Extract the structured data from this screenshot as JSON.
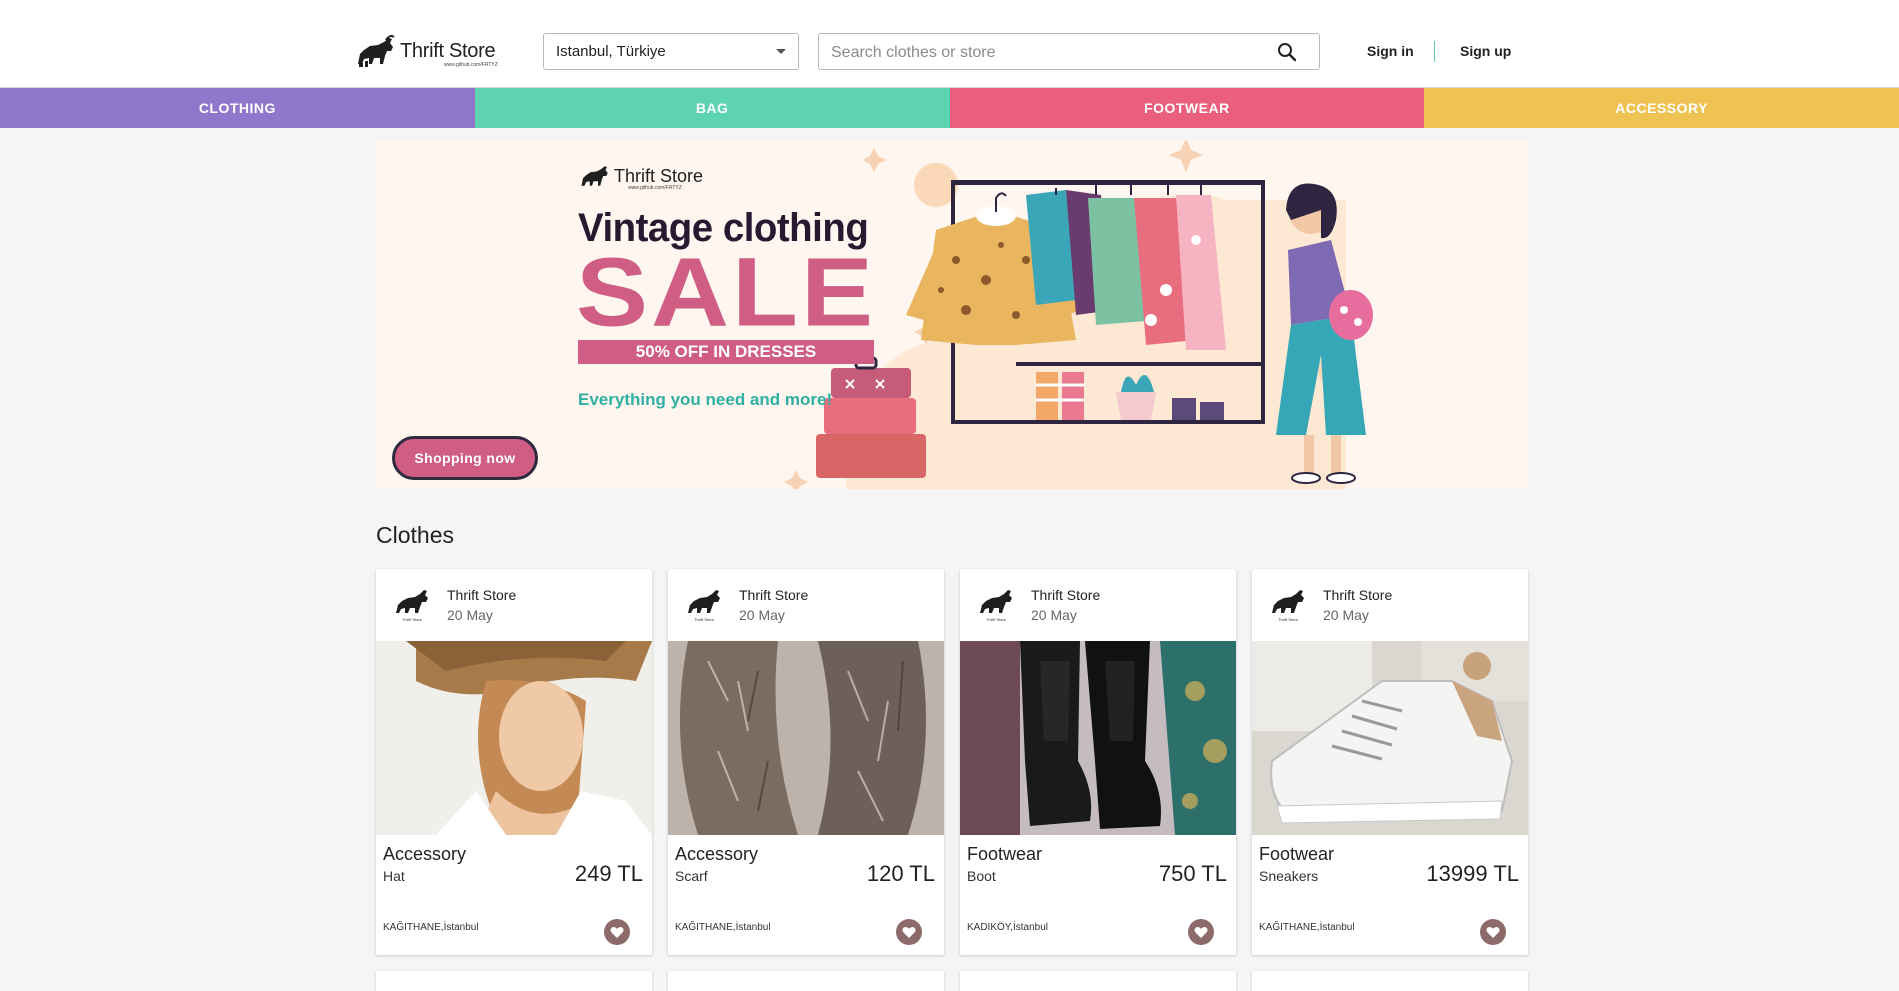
{
  "header": {
    "logo_text": "Thrift Store",
    "logo_sub": "www.github.com/FRTYZ",
    "location": "Istanbul, Türkiye",
    "search_placeholder": "Search clothes or store",
    "sign_in": "Sign in",
    "sign_up": "Sign up"
  },
  "categories": [
    {
      "label": "CLOTHING",
      "color": "#9177cb"
    },
    {
      "label": "BAG",
      "color": "#5dd3b2"
    },
    {
      "label": "FOOTWEAR",
      "color": "#ea5f7b"
    },
    {
      "label": "ACCESSORY",
      "color": "#eec253"
    }
  ],
  "banner": {
    "logo_text": "Thrift Store",
    "logo_sub": "www.github.com/FRTYZ",
    "title": "Vintage clothing",
    "sale": "SALE",
    "offer": "50% OFF IN DRESSES",
    "tagline": "Everything you need and more!",
    "button": "Shopping now"
  },
  "section": {
    "title": "Clothes"
  },
  "products": [
    {
      "store": "Thrift Store",
      "date": "20 May",
      "category": "Accessory",
      "item": "Hat",
      "price": "249 TL",
      "location": "KAĞITHANE,İstanbul",
      "image": "hat-photo"
    },
    {
      "store": "Thrift Store",
      "date": "20 May",
      "category": "Accessory",
      "item": "Scarf",
      "price": "120 TL",
      "location": "KAĞITHANE,İstanbul",
      "image": "fur-scarf-photo"
    },
    {
      "store": "Thrift Store",
      "date": "20 May",
      "category": "Footwear",
      "item": "Boot",
      "price": "750 TL",
      "location": "KADIKÖY,İstanbul",
      "image": "boots-photo"
    },
    {
      "store": "Thrift Store",
      "date": "20 May",
      "category": "Footwear",
      "item": "Sneakers",
      "price": "13999 TL",
      "location": "KAĞITHANE,İstanbul",
      "image": "sneakers-photo"
    }
  ],
  "icons": {
    "search": "search-icon",
    "location_caret": "chevron-down-icon",
    "favorite": "heart-icon",
    "logo": "bull-logo-icon"
  }
}
